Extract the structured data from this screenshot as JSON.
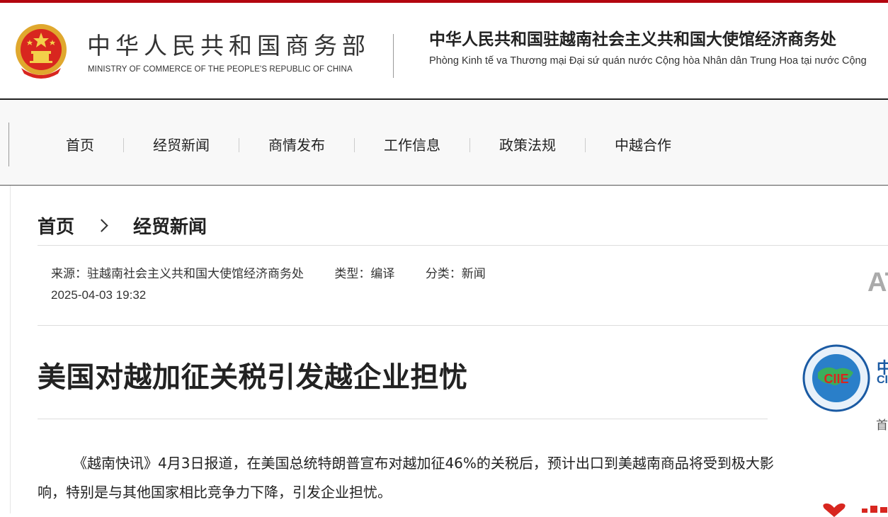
{
  "header": {
    "ministry_cn": "中华人民共和国商务部",
    "ministry_en": "MINISTRY OF COMMERCE OF THE PEOPLE'S REPUBLIC OF CHINA",
    "office_cn": "中华人民共和国驻越南社会主义共和国大使馆经济商务处",
    "office_vi": "Phòng Kinh tế va Thương mại Đại sứ quán nước Cộng hòa Nhân dân Trung Hoa tại nước Cộng"
  },
  "nav": {
    "items": [
      "首页",
      "经贸新闻",
      "商情发布",
      "工作信息",
      "政策法规",
      "中越合作"
    ]
  },
  "breadcrumb": {
    "home": "首页",
    "current": "经贸新闻"
  },
  "meta": {
    "source": "来源：驻越南社会主义共和国大使馆经济商务处",
    "type": "类型：编译",
    "category": "分类：新闻",
    "date": "2025-04-03 19:32"
  },
  "article": {
    "title": "美国对越加征关税引发越企业担忧",
    "paragraph": "《越南快讯》4月3日报道，在美国总统特朗普宣布对越加征46%的关税后，预计出口到美越南商品将受到极大影响，特别是与其他国家相比竞争力下降，引发企业担忧。"
  },
  "sidebar": {
    "at_text": "AT",
    "ciie_cn": "中",
    "ciie_en": "CI",
    "logo_text": "CIIE",
    "side_text": "首"
  },
  "colors": {
    "accent": "#b3050f",
    "ciie_blue": "#1a5aa3"
  }
}
